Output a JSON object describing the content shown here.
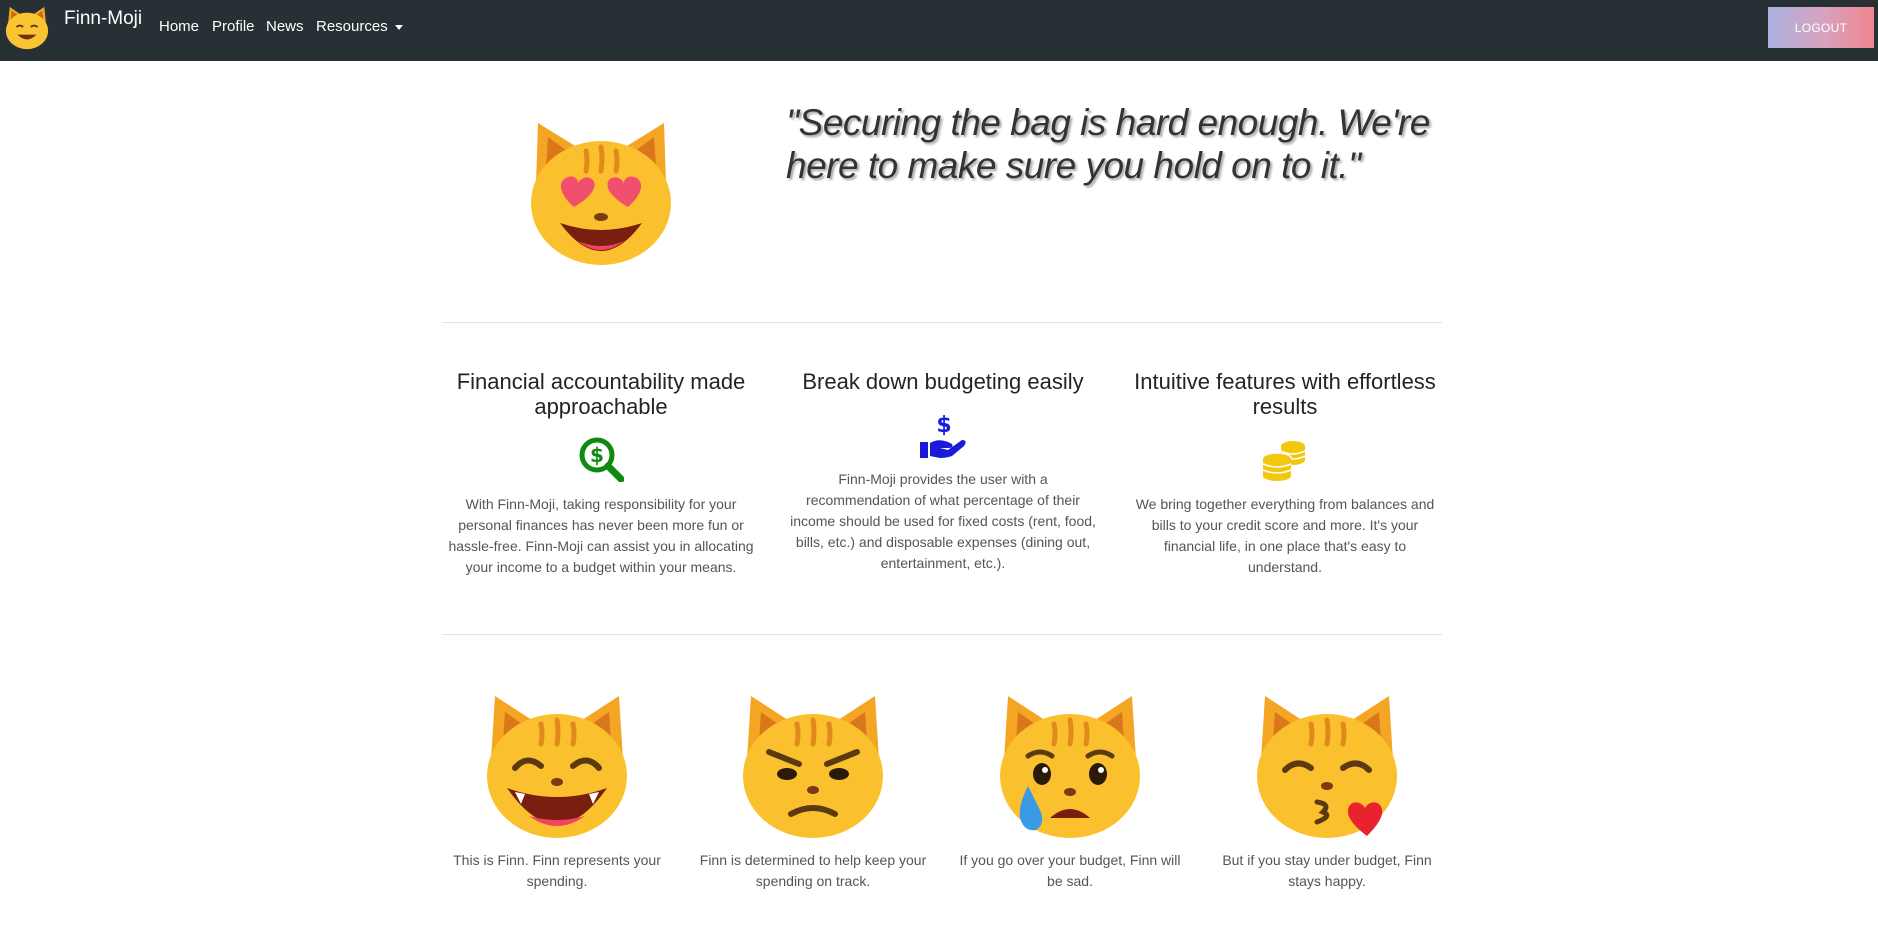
{
  "nav": {
    "brand": "Finn-Moji",
    "links": [
      "Home",
      "Profile",
      "News",
      "Resources"
    ],
    "logout": "LOGOUT",
    "logout_gradient": [
      "#a9b1e0",
      "#f0868f"
    ]
  },
  "hero": {
    "quote": "\"Securing the bag is hard enough. We're here to make sure you hold on to it.\"",
    "icon": "heart-eyes-cat-icon"
  },
  "features": [
    {
      "title": "Financial accountability made approachable",
      "icon": "dollar-magnifier-icon",
      "icon_color": "#0f8a0f",
      "text": "With Finn-Moji, taking responsibility for your personal finances has never been more fun or hassle-free. Finn-Moji can assist you in allocating your income to a budget within your means."
    },
    {
      "title": "Break down budgeting easily",
      "icon": "hand-dollar-icon",
      "icon_color": "#1a1adb",
      "text": "Finn-Moji provides the user with a recommendation of what percentage of their income should be used for fixed costs (rent, food, bills, etc.) and disposable expenses (dining out, entertainment, etc.)."
    },
    {
      "title": "Intuitive features with effortless results",
      "icon": "coins-icon",
      "icon_color": "#f2c80f",
      "text": "We bring together everything from balances and bills to your credit score and more. It's your financial life, in one place that's easy to understand."
    }
  ],
  "cats": [
    {
      "icon": "grinning-cat-icon",
      "caption": "This is Finn. Finn represents your spending."
    },
    {
      "icon": "determined-cat-icon",
      "caption": "Finn is determined to help keep your spending on track."
    },
    {
      "icon": "crying-cat-icon",
      "caption": "If you go over your budget, Finn will be sad."
    },
    {
      "icon": "kissing-heart-cat-icon",
      "caption": "But if you stay under budget, Finn stays happy."
    }
  ]
}
